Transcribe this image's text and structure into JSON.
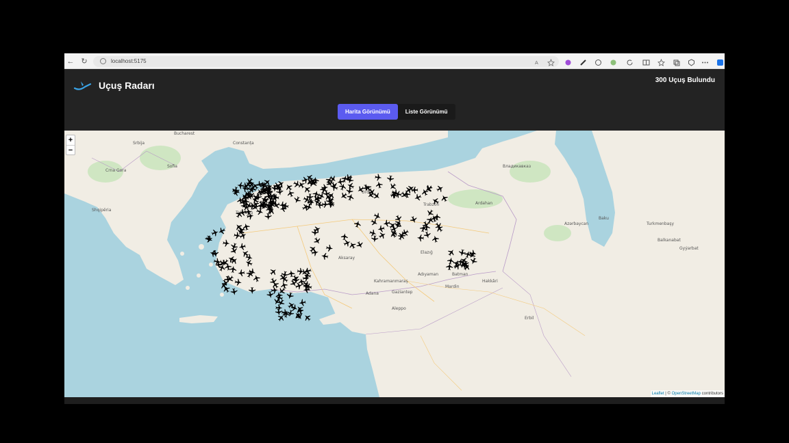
{
  "browser": {
    "url": "localhost:5175"
  },
  "app": {
    "title": "Uçuş Radarı",
    "flight_count_label": "300 Uçuş Bulundu"
  },
  "tabs": [
    {
      "label": "Harita Görünümü",
      "active": true
    },
    {
      "label": "Liste Görünümü",
      "active": false
    }
  ],
  "map": {
    "zoom_in": "+",
    "zoom_out": "−",
    "attribution_leaflet": "Leaflet",
    "attribution_sep": " | © ",
    "attribution_osm": "OpenStreetMap",
    "attribution_tail": " contributors",
    "labels": [
      "Constanța",
      "Bucharest",
      "Kahramanmaraş",
      "Adana",
      "Aksaray",
      "Gaziantep",
      "Elazığ",
      "Mardin",
      "Hakkâri",
      "Batman",
      "Adıyaman",
      "Ordu",
      "Trabzon",
      "Tekirdağ",
      "Sofia",
      "Владикавказ",
      "Baku",
      "Ardahan",
      "Erbil",
      "Azərbaycan",
      "Turkmenbaşy",
      "Balkanabat",
      "Gyýarbat",
      "Crna Gora",
      "Srbija",
      "Shqipëria",
      "Aleppo"
    ],
    "marker_icon": "airplane-icon"
  }
}
